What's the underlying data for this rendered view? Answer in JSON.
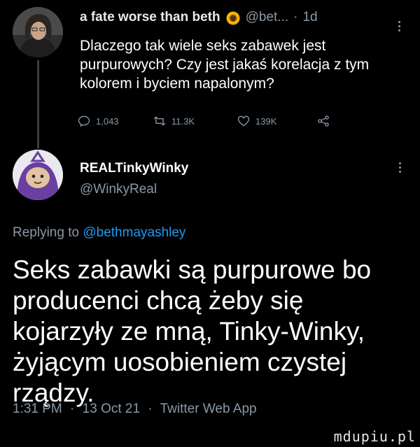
{
  "parent_tweet": {
    "display_name": "a fate worse than beth",
    "name_emoji": "sunflower-icon",
    "handle": "@bet...",
    "time": "1d",
    "text": "Dlaczego tak wiele seks zabawek jest purpurowych? Czy jest jakaś korelacja z tym kolorem i byciem napalonym?",
    "replies": "1,043",
    "retweets": "11.3K",
    "likes": "139K"
  },
  "main_tweet": {
    "display_name": "REALTinkyWinky",
    "handle": "@WinkyReal",
    "replying_prefix": "Replying to",
    "replying_to": "@bethmayashley",
    "text": "Seks zabawki są purpurowe bo producenci chcą żeby się kojarzyły ze mną, Tinky-Winky, żyjącym uosobieniem czystej rządzy.",
    "time": "1:31 PM",
    "date": "13 Oct 21",
    "source": "Twitter Web App"
  },
  "watermark": "mdupiu.pl",
  "colors": {
    "background": "#000000",
    "primary_text": "#ffffff",
    "secondary_text": "#8b98a5",
    "link": "#1d9bf0"
  }
}
